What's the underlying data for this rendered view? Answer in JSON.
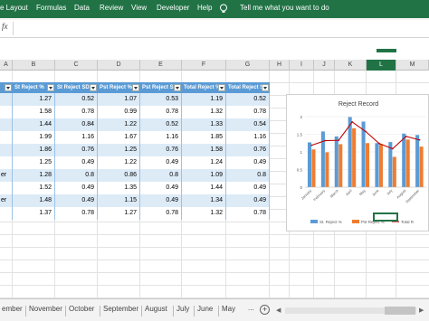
{
  "ribbon": {
    "tabs": [
      "e Layout",
      "Formulas",
      "Data",
      "Review",
      "View",
      "Developer",
      "Help"
    ],
    "tell_me": "Tell me what you want to do",
    "color": "#217346"
  },
  "formula_bar": {
    "fx": "fx",
    "value": ""
  },
  "columns": [
    "A",
    "B",
    "C",
    "D",
    "E",
    "F",
    "G",
    "H",
    "I",
    "J",
    "K",
    "L",
    "M"
  ],
  "selected_column": "L",
  "table": {
    "headers": [
      "",
      "St Reject %",
      "St Reject SD",
      "Pst Reject %",
      "Pst Reject SD",
      "Total Reject %",
      "Total Reject SD"
    ],
    "rows": [
      [
        "",
        "1.27",
        "0.52",
        "1.07",
        "0.53",
        "1.19",
        "0.52"
      ],
      [
        "",
        "1.58",
        "0.78",
        "0.99",
        "0.78",
        "1.32",
        "0.78"
      ],
      [
        "",
        "1.44",
        "0.84",
        "1.22",
        "0.52",
        "1.33",
        "0.54"
      ],
      [
        "",
        "1.99",
        "1.16",
        "1.67",
        "1.16",
        "1.85",
        "1.16"
      ],
      [
        "",
        "1.86",
        "0.76",
        "1.25",
        "0.76",
        "1.58",
        "0.76"
      ],
      [
        "",
        "1.25",
        "0.49",
        "1.22",
        "0.49",
        "1.24",
        "0.49"
      ],
      [
        "er",
        "1.28",
        "0.8",
        "0.86",
        "0.8",
        "1.09",
        "0.8"
      ],
      [
        "",
        "1.52",
        "0.49",
        "1.35",
        "0.49",
        "1.44",
        "0.49"
      ],
      [
        "er",
        "1.48",
        "0.49",
        "1.15",
        "0.49",
        "1.34",
        "0.49"
      ],
      [
        "",
        "1.37",
        "0.78",
        "1.27",
        "0.78",
        "1.32",
        "0.78"
      ]
    ]
  },
  "chart_data": {
    "type": "bar",
    "title": "Reject Record",
    "categories": [
      "January",
      "February",
      "March",
      "April",
      "May",
      "June",
      "July",
      "August",
      "September"
    ],
    "series": [
      {
        "name": "St. Reject %",
        "type": "bar",
        "color": "#5b9bd5",
        "values": [
          1.27,
          1.58,
          1.44,
          1.99,
          1.86,
          1.25,
          1.28,
          1.52,
          1.48
        ]
      },
      {
        "name": "Pst Reject %",
        "type": "bar",
        "color": "#ed7d31",
        "values": [
          1.07,
          0.99,
          1.22,
          1.67,
          1.25,
          1.22,
          0.86,
          1.35,
          1.15
        ]
      },
      {
        "name": "Total R",
        "type": "line",
        "color": "#c00000",
        "values": [
          1.19,
          1.32,
          1.33,
          1.85,
          1.58,
          1.24,
          1.09,
          1.44,
          1.34
        ]
      }
    ],
    "ylim": [
      0,
      2
    ],
    "yticks": [
      "0",
      "0.5",
      "1",
      "1.5",
      "2"
    ],
    "grid": true,
    "legend": "bottom"
  },
  "sheets": [
    "ember",
    "November",
    "October",
    "September",
    "August",
    "July",
    "June",
    "May"
  ],
  "sheets_more": "...",
  "add_sheet": "+"
}
